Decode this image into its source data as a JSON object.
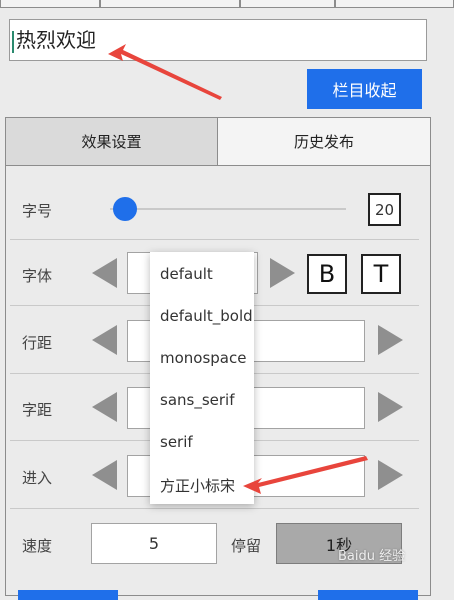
{
  "input": {
    "value": "热烈欢迎"
  },
  "collapse_button": {
    "label": "栏目收起"
  },
  "tabs": [
    {
      "label": "效果设置",
      "active": true
    },
    {
      "label": "历史发布",
      "active": false
    }
  ],
  "rows": {
    "font_size": {
      "label": "字号",
      "value": "20"
    },
    "font": {
      "label": "字体",
      "bold_label": "B",
      "text_label": "T"
    },
    "line_spacing": {
      "label": "行距"
    },
    "letter_spacing": {
      "label": "字距"
    },
    "enter": {
      "label": "进入"
    },
    "speed": {
      "label": "速度",
      "value": "5"
    },
    "stay": {
      "label": "停留",
      "value": "1秒"
    }
  },
  "font_dropdown": {
    "options": [
      "default",
      "default_bold",
      "monospace",
      "sans_serif",
      "serif",
      "方正小标宋"
    ]
  },
  "watermark": {
    "text": "Baidu 经验"
  },
  "colors": {
    "accent": "#1f6fea",
    "arrow": "#e8453c"
  }
}
